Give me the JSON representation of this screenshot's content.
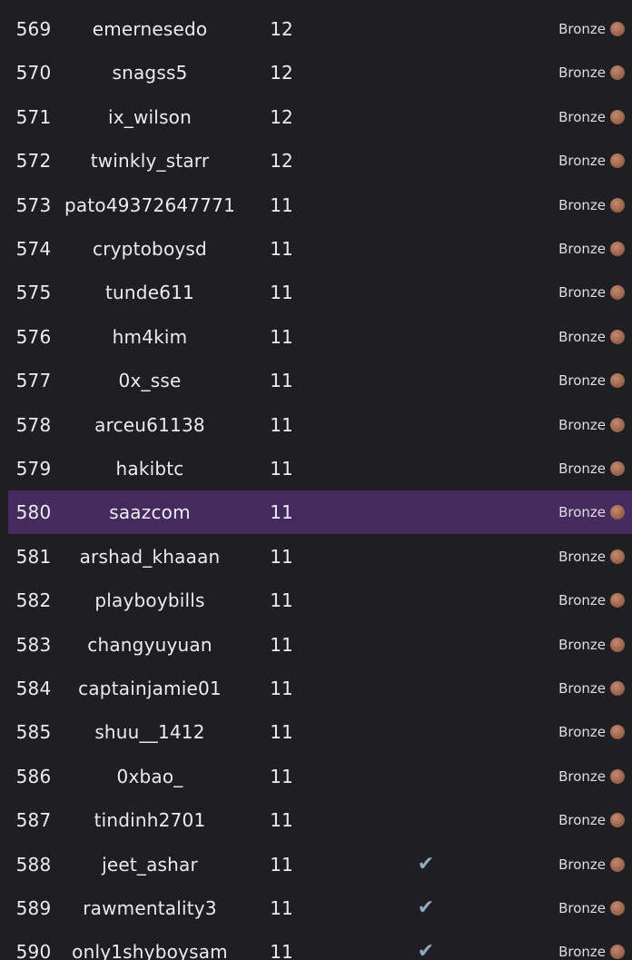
{
  "leaderboard": {
    "rows": [
      {
        "rank": "569",
        "name": "emernesedo",
        "score": "12",
        "verified": false,
        "tier": "Bronze",
        "highlight": false
      },
      {
        "rank": "570",
        "name": "snagss5",
        "score": "12",
        "verified": false,
        "tier": "Bronze",
        "highlight": false
      },
      {
        "rank": "571",
        "name": "ix_wilson",
        "score": "12",
        "verified": false,
        "tier": "Bronze",
        "highlight": false
      },
      {
        "rank": "572",
        "name": "twinkly_starr",
        "score": "12",
        "verified": false,
        "tier": "Bronze",
        "highlight": false
      },
      {
        "rank": "573",
        "name": "pato49372647771",
        "score": "11",
        "verified": false,
        "tier": "Bronze",
        "highlight": false
      },
      {
        "rank": "574",
        "name": "cryptoboysd",
        "score": "11",
        "verified": false,
        "tier": "Bronze",
        "highlight": false
      },
      {
        "rank": "575",
        "name": "tunde611",
        "score": "11",
        "verified": false,
        "tier": "Bronze",
        "highlight": false
      },
      {
        "rank": "576",
        "name": "hm4kim",
        "score": "11",
        "verified": false,
        "tier": "Bronze",
        "highlight": false
      },
      {
        "rank": "577",
        "name": "0x_sse",
        "score": "11",
        "verified": false,
        "tier": "Bronze",
        "highlight": false
      },
      {
        "rank": "578",
        "name": "arceu61138",
        "score": "11",
        "verified": false,
        "tier": "Bronze",
        "highlight": false
      },
      {
        "rank": "579",
        "name": "hakibtc",
        "score": "11",
        "verified": false,
        "tier": "Bronze",
        "highlight": false
      },
      {
        "rank": "580",
        "name": "saazcom",
        "score": "11",
        "verified": false,
        "tier": "Bronze",
        "highlight": true
      },
      {
        "rank": "581",
        "name": "arshad_khaaan",
        "score": "11",
        "verified": false,
        "tier": "Bronze",
        "highlight": false
      },
      {
        "rank": "582",
        "name": "playboybills",
        "score": "11",
        "verified": false,
        "tier": "Bronze",
        "highlight": false
      },
      {
        "rank": "583",
        "name": "changyuyuan",
        "score": "11",
        "verified": false,
        "tier": "Bronze",
        "highlight": false
      },
      {
        "rank": "584",
        "name": "captainjamie01",
        "score": "11",
        "verified": false,
        "tier": "Bronze",
        "highlight": false
      },
      {
        "rank": "585",
        "name": "shuu__1412",
        "score": "11",
        "verified": false,
        "tier": "Bronze",
        "highlight": false
      },
      {
        "rank": "586",
        "name": "0xbao_",
        "score": "11",
        "verified": false,
        "tier": "Bronze",
        "highlight": false
      },
      {
        "rank": "587",
        "name": "tindinh2701",
        "score": "11",
        "verified": false,
        "tier": "Bronze",
        "highlight": false
      },
      {
        "rank": "588",
        "name": "jeet_ashar",
        "score": "11",
        "verified": true,
        "tier": "Bronze",
        "highlight": false
      },
      {
        "rank": "589",
        "name": "rawmentality3",
        "score": "11",
        "verified": true,
        "tier": "Bronze",
        "highlight": false
      },
      {
        "rank": "590",
        "name": "only1shyboysam",
        "score": "11",
        "verified": true,
        "tier": "Bronze",
        "highlight": false
      }
    ],
    "check_glyph": "✔",
    "colors": {
      "background": "#1f1e22",
      "highlight_row": "#452a5e",
      "bronze_medal": "#a0674f",
      "check": "#93a7bd"
    }
  }
}
